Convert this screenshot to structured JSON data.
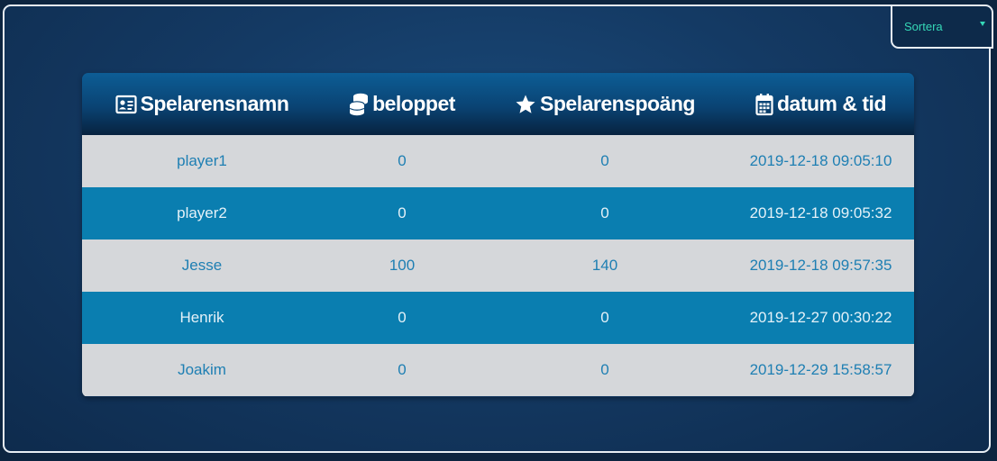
{
  "sort": {
    "label": "Sortera"
  },
  "table": {
    "headers": [
      {
        "label": "Spelarensnamn",
        "icon": "id-card-icon"
      },
      {
        "label": "beloppet",
        "icon": "coins-icon"
      },
      {
        "label": "Spelarenspoäng",
        "icon": "star-icon"
      },
      {
        "label": "datum & tid",
        "icon": "calendar-icon"
      }
    ],
    "rows": [
      [
        "player1",
        "0",
        "0",
        "2019-12-18 09:05:10"
      ],
      [
        "player2",
        "0",
        "0",
        "2019-12-18 09:05:32"
      ],
      [
        "Jesse",
        "100",
        "140",
        "2019-12-18 09:57:35"
      ],
      [
        "Henrik",
        "0",
        "0",
        "2019-12-27 00:30:22"
      ],
      [
        "Joakim",
        "0",
        "0",
        "2019-12-29 15:58:57"
      ]
    ]
  },
  "colors": {
    "row_light": "#d5d7da",
    "row_blue": "#0a7eb0",
    "text_blue": "#1e7fb3",
    "accent_teal": "#35d8b7"
  }
}
